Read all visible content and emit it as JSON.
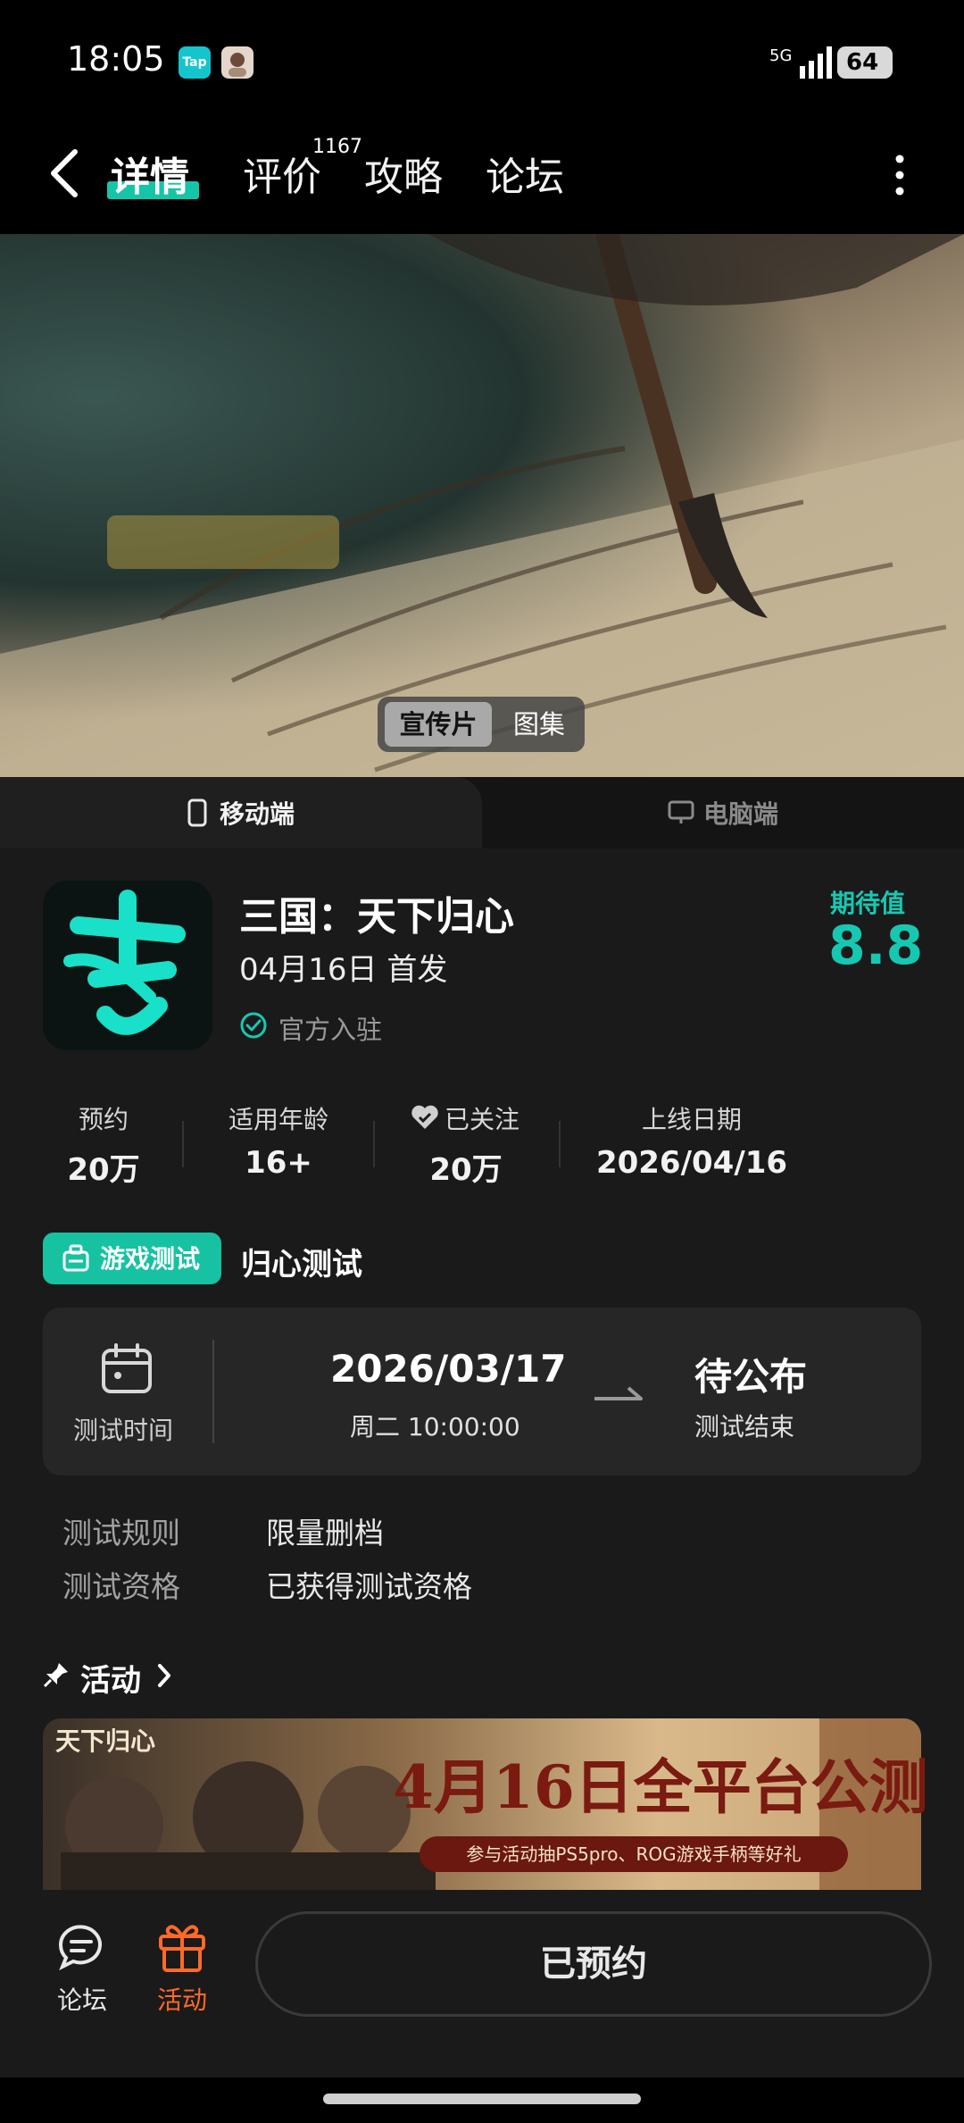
{
  "status_bar": {
    "time": "18:05",
    "tap_label": "Tap",
    "network": "5G",
    "battery": "64"
  },
  "header": {
    "tabs": [
      {
        "label": "详情",
        "active": true
      },
      {
        "label": "评价",
        "count": "1167"
      },
      {
        "label": "攻略"
      },
      {
        "label": "论坛"
      }
    ]
  },
  "hero": {
    "media_tabs": [
      {
        "label": "宣传片",
        "active": true
      },
      {
        "label": "图集"
      }
    ]
  },
  "platform_tabs": [
    {
      "label": "移动端",
      "active": true
    },
    {
      "label": "电脑端"
    }
  ],
  "game": {
    "title": "三国：天下归心",
    "release_text": "04月16日 首发",
    "verified": "官方入驻",
    "expectation_label": "期待值",
    "expectation_score": "8.8",
    "accent_color": "#16c8b2"
  },
  "stats": [
    {
      "label": "预约",
      "value": "20万"
    },
    {
      "label": "适用年龄",
      "value": "16+"
    },
    {
      "label": "已关注",
      "value": "20万"
    },
    {
      "label": "上线日期",
      "value": "2026/04/16"
    }
  ],
  "test": {
    "badge": "游戏测试",
    "name": "归心测试",
    "time_label": "测试时间",
    "start_date": "2026/03/17",
    "start_time": "周二  10:00:00",
    "end_status": "待公布",
    "end_label": "测试结束",
    "rules": [
      {
        "label": "测试规则",
        "value": "限量删档"
      },
      {
        "label": "测试资格",
        "value": "已获得测试资格"
      }
    ]
  },
  "activity": {
    "title": "活动",
    "banner_logo": "天下归心",
    "banner_headline": "4月16日全平台公测",
    "banner_sub": "参与活动抽PS5pro、ROG游戏手柄等好礼"
  },
  "bottom_nav": {
    "forum_label": "论坛",
    "activity_label": "活动",
    "reserve_button": "已预约",
    "activity_color": "#ff6a28"
  }
}
